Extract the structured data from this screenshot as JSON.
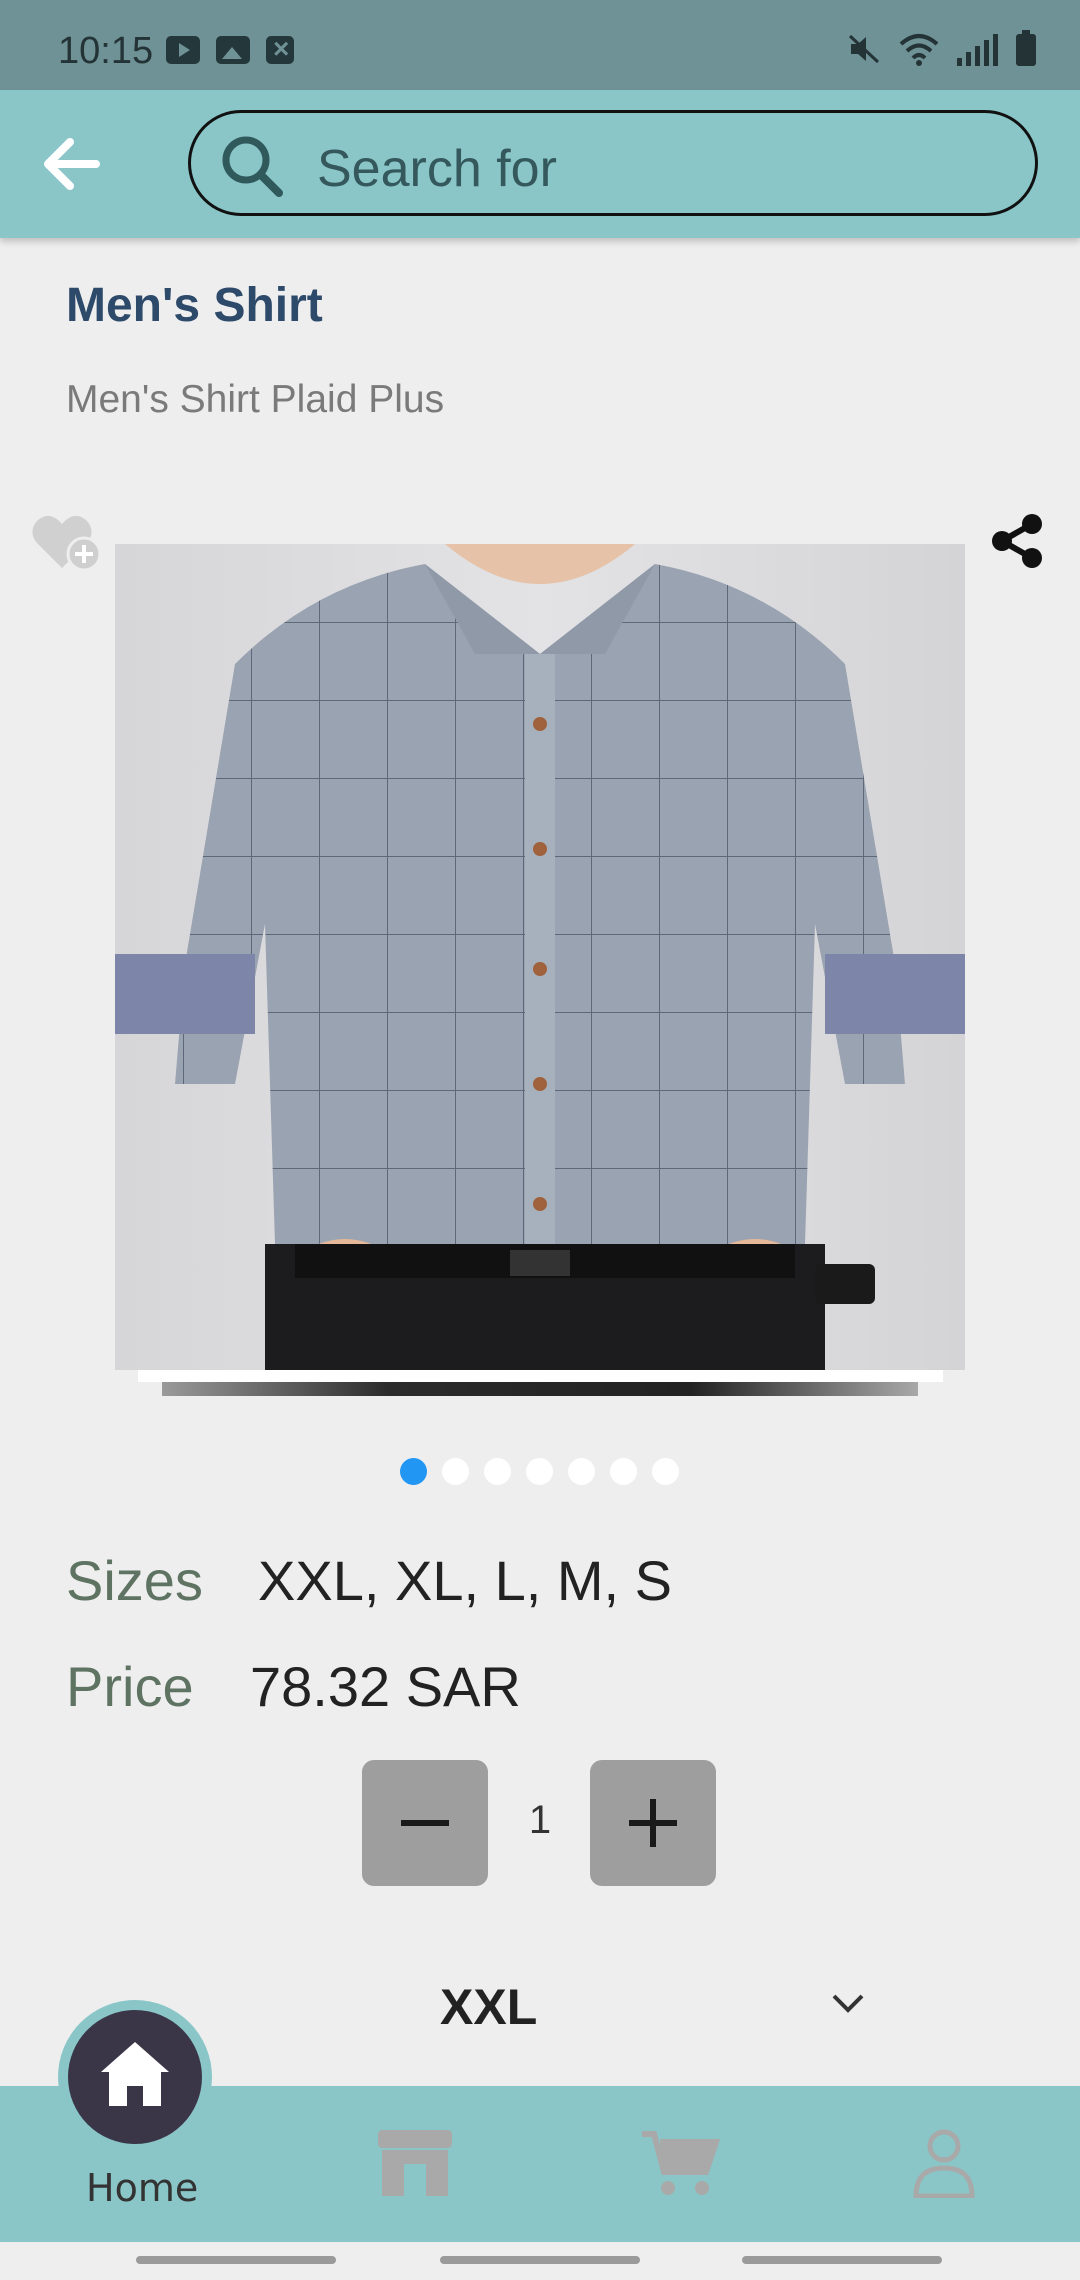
{
  "status_bar": {
    "time": "10:15"
  },
  "search": {
    "placeholder": "Search for"
  },
  "product": {
    "title": "Men's Shirt",
    "subtitle": "Men's Shirt Plaid Plus",
    "sizes_label": "Sizes",
    "sizes_value": "XXL, XL, L, M, S",
    "price_label": "Price",
    "price_value": "78.32 SAR",
    "image_dots_count": 7,
    "image_active_index": 0
  },
  "quantity": {
    "value": "1"
  },
  "size_select": {
    "value": "XXL"
  },
  "bottom_nav": {
    "items": [
      {
        "label": "Home",
        "icon": "home-icon",
        "active": true
      },
      {
        "label": "",
        "icon": "store-icon",
        "active": false
      },
      {
        "label": "",
        "icon": "cart-icon",
        "active": false
      },
      {
        "label": "",
        "icon": "user-icon",
        "active": false
      }
    ]
  },
  "colors": {
    "accent": "#8ac6c8",
    "status_bar": "#6f9296",
    "title": "#2d4a6a",
    "active_dot": "#2196f3"
  }
}
